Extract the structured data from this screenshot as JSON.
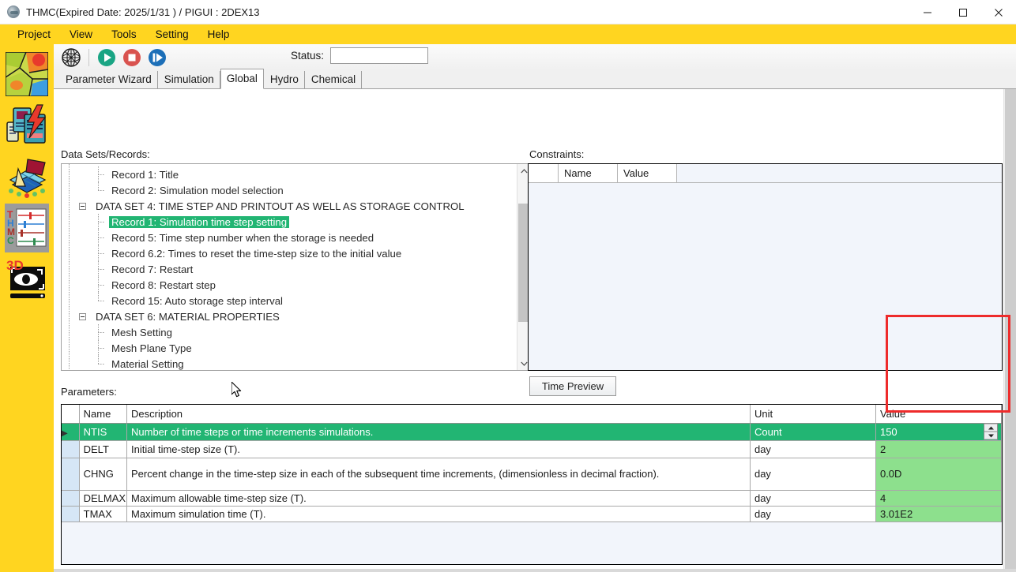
{
  "window": {
    "title": "THMC(Expired Date: 2025/1/31 ) / PIGUI : 2DEX13",
    "icon": "app-globe-icon",
    "minimize": "−",
    "maximize": "□",
    "close": "×"
  },
  "menu": {
    "items": [
      {
        "label": "Project"
      },
      {
        "label": "View"
      },
      {
        "label": "Tools"
      },
      {
        "label": "Setting"
      },
      {
        "label": "Help"
      }
    ]
  },
  "rail": {
    "items": [
      {
        "name": "geology-map-icon",
        "selected": false
      },
      {
        "name": "documents-lightning-icon",
        "selected": false
      },
      {
        "name": "mesh-plane-3d-icon",
        "selected": false
      },
      {
        "name": "thmc-sliders-icon",
        "selected": true
      },
      {
        "name": "3d-view-eye-icon",
        "selected": false
      }
    ]
  },
  "toolbar": {
    "mesh_icon": "mesh-globe-icon",
    "run_icon": "play-icon",
    "stop_icon": "stop-icon",
    "step_icon": "step-forward-icon",
    "status_label": "Status:",
    "status_value": "",
    "status_placeholder": ""
  },
  "tabs": [
    {
      "label": "Parameter Wizard",
      "active": false
    },
    {
      "label": "Simulation",
      "active": false
    },
    {
      "label": "Global",
      "active": true
    },
    {
      "label": "Hydro",
      "active": false
    },
    {
      "label": "Chemical",
      "active": false
    }
  ],
  "panels": {
    "datasets_label": "Data Sets/Records:",
    "constraints_label": "Constraints:",
    "parameters_label": "Parameters:",
    "time_preview_button": "Time Preview"
  },
  "tree": {
    "nodes": [
      {
        "label": "Record 1: Title",
        "level": 2,
        "type": "leaf",
        "selected": false
      },
      {
        "label": "Record 2: Simulation model selection",
        "level": 2,
        "type": "leaf-last",
        "selected": false
      },
      {
        "label": "DATA SET 4: TIME STEP AND PRINTOUT AS WELL AS STORAGE CONTROL",
        "level": 1,
        "type": "group-open",
        "selected": false
      },
      {
        "label": "Record 1: Simulation time step setting",
        "level": 2,
        "type": "leaf",
        "selected": true
      },
      {
        "label": "Record 5: Time step number when the storage is needed",
        "level": 2,
        "type": "leaf",
        "selected": false
      },
      {
        "label": "Record 6.2:  Times to reset the time-step size to the initial value",
        "level": 2,
        "type": "leaf",
        "selected": false
      },
      {
        "label": "Record 7: Restart",
        "level": 2,
        "type": "leaf",
        "selected": false
      },
      {
        "label": "Record 8: Restart step",
        "level": 2,
        "type": "leaf",
        "selected": false
      },
      {
        "label": "Record 15: Auto storage step interval",
        "level": 2,
        "type": "leaf-last",
        "selected": false
      },
      {
        "label": "DATA SET 6: MATERIAL PROPERTIES",
        "level": 1,
        "type": "group-open",
        "selected": false
      },
      {
        "label": "Mesh Setting",
        "level": 2,
        "type": "leaf",
        "selected": false
      },
      {
        "label": "Mesh Plane Type",
        "level": 2,
        "type": "leaf",
        "selected": false
      },
      {
        "label": "Material Setting",
        "level": 2,
        "type": "leaf-last",
        "selected": false
      }
    ]
  },
  "constraints": {
    "columns": [
      "",
      "Name",
      "Value"
    ],
    "rows": []
  },
  "parameters": {
    "columns": [
      "",
      "Name",
      "Description",
      "Unit",
      "Value"
    ],
    "rows": [
      {
        "selector": "▶",
        "name": "NTIS",
        "description": "Number of time steps or time increments simulations.",
        "unit": "Count",
        "value": "150",
        "selected": true,
        "has_spinner": true
      },
      {
        "selector": "",
        "name": "DELT",
        "description": "Initial time-step size (T).",
        "unit": "day",
        "value": "2",
        "selected": false,
        "has_spinner": false
      },
      {
        "selector": "",
        "name": "CHNG",
        "description": "Percent change in the time-step size in each of the subsequent time increments, (dimensionless in decimal fraction).",
        "unit": "day",
        "value": "0.0D",
        "selected": false,
        "has_spinner": false
      },
      {
        "selector": "",
        "name": "DELMAX",
        "description": "Maximum allowable time-step size (T).",
        "unit": "day",
        "value": "4",
        "selected": false,
        "has_spinner": false
      },
      {
        "selector": "",
        "name": "TMAX",
        "description": "Maximum simulation time (T).",
        "unit": "day",
        "value": "3.01E2",
        "selected": false,
        "has_spinner": false
      }
    ]
  },
  "colors": {
    "menu_bar": "#ffd520",
    "rail": "#ffd520",
    "selected_row": "#22b573",
    "value_cell": "#8de08d",
    "highlight_box": "#ee2b2b",
    "row_selector": "#d6e6f6"
  }
}
